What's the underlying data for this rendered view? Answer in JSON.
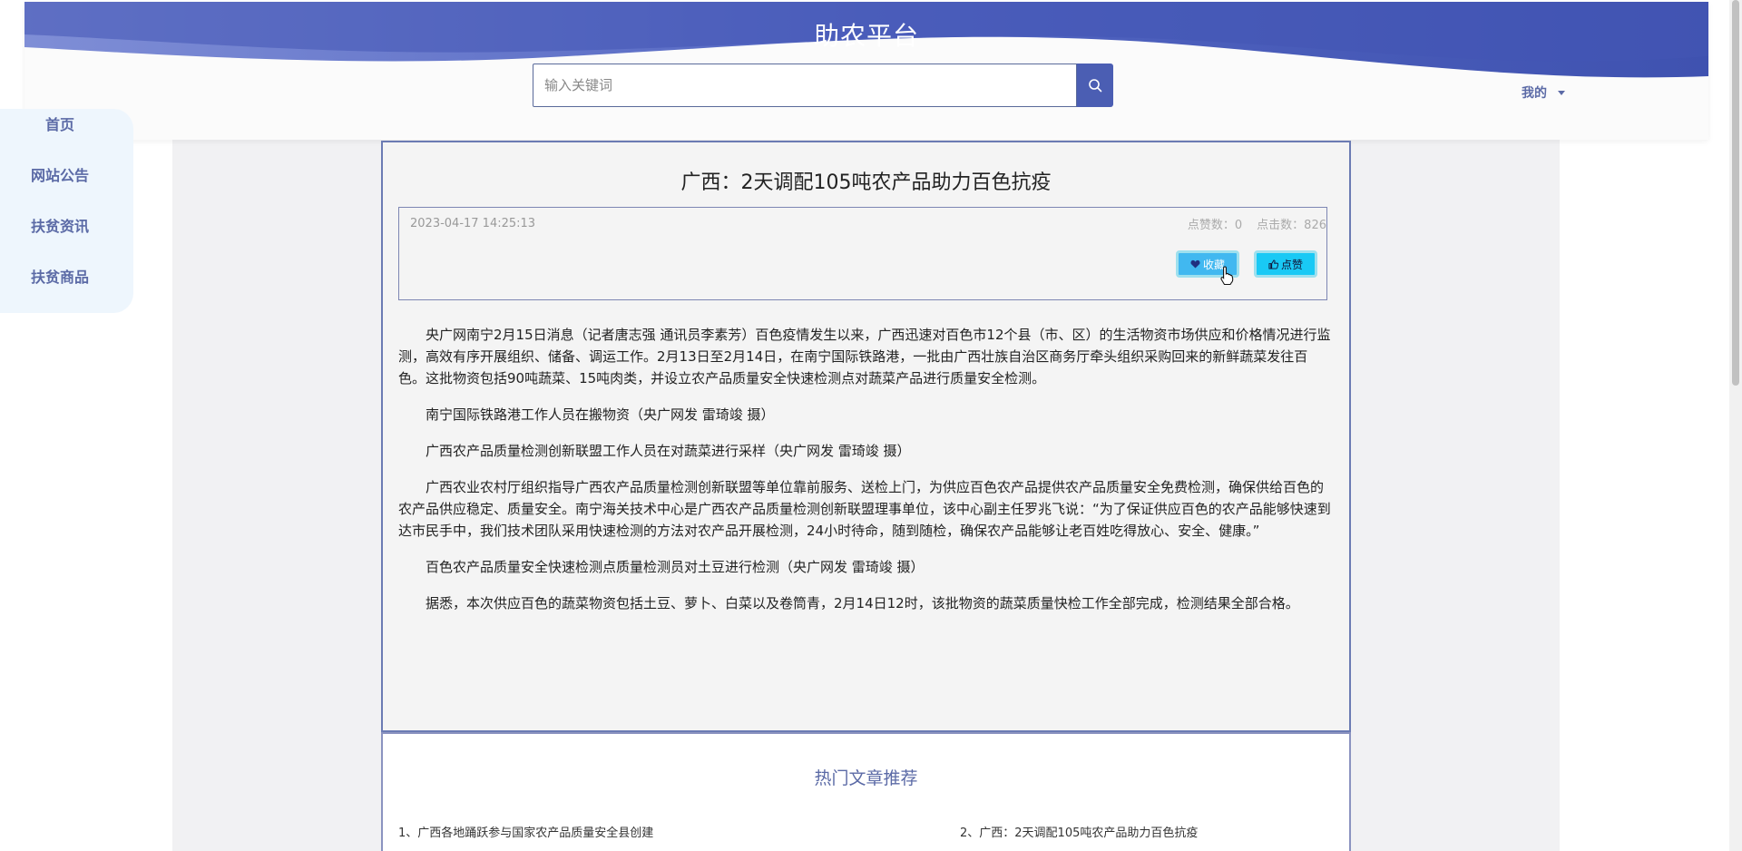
{
  "header": {
    "site_title": "助农平台",
    "search_placeholder": "输入关键词",
    "search_icon": "search-icon",
    "user_menu_label": "我的",
    "wave_colors": [
      "#4b5eb3",
      "#8a9ae0"
    ]
  },
  "sidebar": {
    "items": [
      {
        "label": "首页"
      },
      {
        "label": "网站公告"
      },
      {
        "label": "扶贫资讯"
      },
      {
        "label": "扶贫商品"
      }
    ]
  },
  "article": {
    "title": "广西：2天调配105吨农产品助力百色抗疫",
    "date": "2023-04-17 14:25:13",
    "likes_label": "点赞数：0",
    "clicks_label": "点击数：826",
    "favorite_label": "收藏",
    "like_label": "点赞",
    "paragraphs": [
      "央广网南宁2月15日消息（记者唐志强 通讯员李素芳）百色疫情发生以来，广西迅速对百色市12个县（市、区）的生活物资市场供应和价格情况进行监测，高效有序开展组织、储备、调运工作。2月13日至2月14日，在南宁国际铁路港，一批由广西壮族自治区商务厅牵头组织采购回来的新鲜蔬菜发往百色。这批物资包括90吨蔬菜、15吨肉类，并设立农产品质量安全快速检测点对蔬菜产品进行质量安全检测。",
      "南宁国际铁路港工作人员在搬物资（央广网发 雷琦竣 摄）",
      "广西农产品质量检测创新联盟工作人员在对蔬菜进行采样（央广网发 雷琦竣 摄）",
      "广西农业农村厅组织指导广西农产品质量检测创新联盟等单位靠前服务、送检上门，为供应百色农产品提供农产品质量安全免费检测，确保供给百色的农产品供应稳定、质量安全。南宁海关技术中心是广西农产品质量检测创新联盟理事单位，该中心副主任罗兆飞说：“为了保证供应百色的农产品能够快速到达市民手中，我们技术团队采用快速检测的方法对农产品开展检测，24小时待命，随到随检，确保农产品能够让老百姓吃得放心、安全、健康。”",
      "百色农产品质量安全快速检测点质量检测员对土豆进行检测（央广网发 雷琦竣 摄）",
      "据悉，本次供应百色的蔬菜物资包括土豆、萝卜、白菜以及卷筒青，2月14日12时，该批物资的蔬菜质量快检工作全部完成，检测结果全部合格。"
    ]
  },
  "recommend": {
    "title": "热门文章推荐",
    "items": [
      {
        "label": "1、广西各地踊跃参与国家农产品质量安全县创建"
      },
      {
        "label": "2、广西：2天调配105吨农产品助力百色抗疫"
      }
    ]
  }
}
